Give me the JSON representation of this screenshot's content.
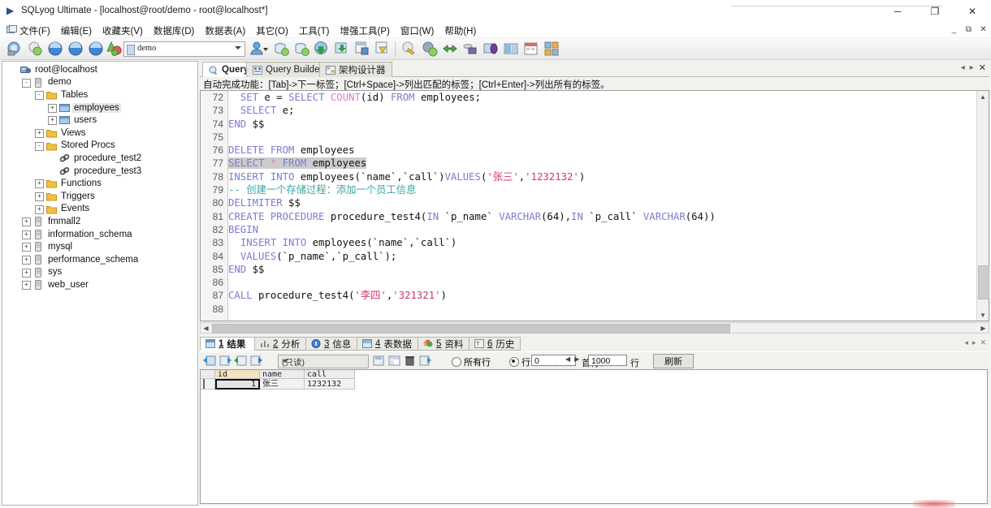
{
  "window": {
    "title": "SQLyog Ultimate - [localhost@root/demo - root@localhost*]",
    "minimize": "─",
    "maximize": "❐",
    "close": "✕",
    "mdi_minimize": "_",
    "mdi_restore": "⧉",
    "mdi_close": "✕"
  },
  "menubar": {
    "items": [
      "文件(F)",
      "编辑(E)",
      "收藏夹(V)",
      "数据库(D)",
      "数据表(A)",
      "其它(O)",
      "工具(T)",
      "增强工具(P)",
      "窗口(W)",
      "帮助(H)"
    ]
  },
  "toolbar": {
    "database_selected": "demo",
    "icons": [
      "new-connection-icon",
      "refresh-object-icon",
      "new-query-tab-icon",
      "open-query-icon",
      "save-query-icon",
      "execute-query-icon",
      "user-manager-icon",
      "import-data-icon",
      "export-data-icon",
      "backup-database-icon",
      "restore-database-icon",
      "schema-sync-icon",
      "query-builder-icon",
      "sql-formatter-icon",
      "edit-icon",
      "find-icon",
      "sync-data-icon",
      "tunnel-icon",
      "migration-icon",
      "visual-diff-icon",
      "scheduler-icon",
      "power-tools-icon"
    ]
  },
  "sidebar": {
    "nodes": [
      {
        "label": "root@localhost",
        "depth": 0,
        "icon": "server-icon",
        "expander": null,
        "selected": false
      },
      {
        "label": "demo",
        "depth": 1,
        "icon": "database-icon",
        "expander": "-",
        "selected": false
      },
      {
        "label": "Tables",
        "depth": 2,
        "icon": "folder-icon",
        "expander": "-",
        "selected": false
      },
      {
        "label": "employees",
        "depth": 3,
        "icon": "table-icon",
        "expander": "+",
        "selected": true
      },
      {
        "label": "users",
        "depth": 3,
        "icon": "table-icon",
        "expander": "+",
        "selected": false
      },
      {
        "label": "Views",
        "depth": 2,
        "icon": "folder-icon",
        "expander": "+",
        "selected": false
      },
      {
        "label": "Stored Procs",
        "depth": 2,
        "icon": "folder-icon",
        "expander": "-",
        "selected": false
      },
      {
        "label": "procedure_test2",
        "depth": 3,
        "icon": "procedure-icon",
        "expander": null,
        "selected": false
      },
      {
        "label": "procedure_test3",
        "depth": 3,
        "icon": "procedure-icon",
        "expander": null,
        "selected": false
      },
      {
        "label": "Functions",
        "depth": 2,
        "icon": "folder-icon",
        "expander": "+",
        "selected": false
      },
      {
        "label": "Triggers",
        "depth": 2,
        "icon": "folder-icon",
        "expander": "+",
        "selected": false
      },
      {
        "label": "Events",
        "depth": 2,
        "icon": "folder-icon",
        "expander": "+",
        "selected": false
      },
      {
        "label": "fmmall2",
        "depth": 1,
        "icon": "database-icon",
        "expander": "+",
        "selected": false
      },
      {
        "label": "information_schema",
        "depth": 1,
        "icon": "database-icon",
        "expander": "+",
        "selected": false
      },
      {
        "label": "mysql",
        "depth": 1,
        "icon": "database-icon",
        "expander": "+",
        "selected": false
      },
      {
        "label": "performance_schema",
        "depth": 1,
        "icon": "database-icon",
        "expander": "+",
        "selected": false
      },
      {
        "label": "sys",
        "depth": 1,
        "icon": "database-icon",
        "expander": "+",
        "selected": false
      },
      {
        "label": "web_user",
        "depth": 1,
        "icon": "database-icon",
        "expander": "+",
        "selected": false
      }
    ]
  },
  "editor": {
    "tabs": [
      {
        "label": "Query",
        "icon": "query-icon",
        "active": true
      },
      {
        "label": "Query Builder",
        "icon": "query-builder-icon",
        "active": false
      },
      {
        "label": "架构设计器",
        "icon": "schema-designer-icon",
        "active": false
      }
    ],
    "hint": "自动完成功能：[Tab]->下一标签；[Ctrl+Space]->列出匹配的标签；[Ctrl+Enter]->列出所有的标签。",
    "first_line_number": 72,
    "lines": [
      {
        "n": 72,
        "html": "  <span class='kw'>SET</span> e = <span class='kw'>SELECT</span> <span class='fn'>COUNT</span>(id) <span class='kw'>FROM</span> employees;"
      },
      {
        "n": 73,
        "html": "  <span class='kw'>SELECT</span> e;"
      },
      {
        "n": 74,
        "html": "<span class='kw'>END</span> $$"
      },
      {
        "n": 75,
        "html": ""
      },
      {
        "n": 76,
        "html": "<span class='kw'>DELETE FROM</span> employees"
      },
      {
        "n": 77,
        "html": "<span class='hl'><span class='kw'>SELECT</span> <span class='fn'>*</span> <span class='kw'>FROM</span> employees</span>"
      },
      {
        "n": 78,
        "html": "<span class='kw'>INSERT INTO</span> employees(`name`,`call`)<span class='kw'>VALUES</span>(<span class='str'>'张三'</span>,<span class='str'>'1232132'</span>)"
      },
      {
        "n": 79,
        "html": "<span class='cmt'>-- 创建一个存储过程：添加一个员工信息</span>"
      },
      {
        "n": 80,
        "html": "<span class='kw'>DELIMITER</span> $$"
      },
      {
        "n": 81,
        "html": "<span class='kw'>CREATE PROCEDURE</span> procedure_test4(<span class='kw'>IN</span> `p_name` <span class='kw'>VARCHAR</span>(64),<span class='kw'>IN</span> `p_call` <span class='kw'>VARCHAR</span>(64))"
      },
      {
        "n": 82,
        "html": "<span class='kw'>BEGIN</span>"
      },
      {
        "n": 83,
        "html": "  <span class='kw'>INSERT INTO</span> employees(`name`,`call`)"
      },
      {
        "n": 84,
        "html": "  <span class='kw'>VALUES</span>(`p_name`,`p_call`);"
      },
      {
        "n": 85,
        "html": "<span class='kw'>END</span> $$"
      },
      {
        "n": 86,
        "html": ""
      },
      {
        "n": 87,
        "html": "<span class='kw'>CALL</span> procedure_test4(<span class='str'>'李四'</span>,<span class='str'>'321321'</span>)"
      },
      {
        "n": 88,
        "html": ""
      }
    ],
    "selected_line_text": "SELECT * FROM employees"
  },
  "results": {
    "tabs": [
      {
        "num": "1",
        "label": "结果",
        "active": true,
        "icon": "result-grid-icon"
      },
      {
        "num": "2",
        "label": "分析",
        "active": false,
        "icon": "profiler-icon"
      },
      {
        "num": "3",
        "label": "信息",
        "active": false,
        "icon": "message-icon"
      },
      {
        "num": "4",
        "label": "表数据",
        "active": false,
        "icon": "table-data-icon"
      },
      {
        "num": "5",
        "label": "资料",
        "active": false,
        "icon": "info-icon"
      },
      {
        "num": "6",
        "label": "历史",
        "active": false,
        "icon": "history-icon"
      }
    ],
    "grid_toolbar": {
      "mode_value": "(只读)",
      "radio_all_rows": "所有行",
      "radio_row_range": "行的范围",
      "radio_selected": "行的范围",
      "first_row_label": "首行：",
      "first_row_value": "0",
      "limit_value": "1000",
      "rows_unit": "行",
      "refresh_button": "刷新",
      "icons": [
        "insert-row-icon",
        "duplicate-row-icon",
        "update-row-icon",
        "commit-icon",
        "save-changes-icon",
        "export-grid-icon",
        "delete-row-icon",
        "refresh-grid-icon"
      ]
    },
    "grid": {
      "columns": [
        "id",
        "name",
        "call"
      ],
      "key_column": "id",
      "rows": [
        {
          "id": "1",
          "name": "张三",
          "call": "1232132"
        }
      ]
    }
  }
}
